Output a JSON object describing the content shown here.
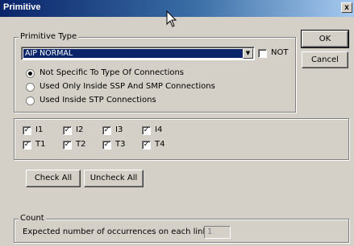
{
  "window": {
    "title": "Primitive",
    "close_glyph": "x"
  },
  "primitive_type": {
    "group_label": "Primitive Type",
    "selected": "AIP NORMAL",
    "not_label": "NOT",
    "not_checked": false,
    "options": [
      {
        "label": "Not Specific To Type Of Connections",
        "selected": true
      },
      {
        "label": "Used Only Inside SSP And SMP Connections",
        "selected": false
      },
      {
        "label": "Used Inside STP Connections",
        "selected": false
      }
    ]
  },
  "buttons": {
    "ok": "OK",
    "cancel": "Cancel",
    "check_all": "Check All",
    "uncheck_all": "Uncheck All"
  },
  "checks": [
    {
      "label": "I1",
      "checked": true
    },
    {
      "label": "I2",
      "checked": true
    },
    {
      "label": "I3",
      "checked": true
    },
    {
      "label": "I4",
      "checked": true
    },
    {
      "label": "T1",
      "checked": true
    },
    {
      "label": "T2",
      "checked": true
    },
    {
      "label": "T3",
      "checked": true
    },
    {
      "label": "T4",
      "checked": true
    }
  ],
  "count": {
    "group_label": "Count",
    "label": "Expected number of occurrences on each link:",
    "value": "1"
  },
  "colors": {
    "titlebar": "#0a246a",
    "face": "#d4d0c8",
    "selection": "#0a246a"
  }
}
